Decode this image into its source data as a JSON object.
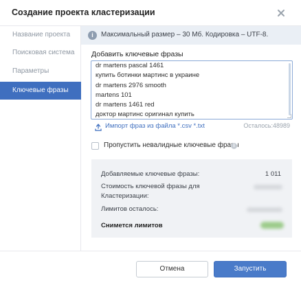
{
  "dialog": {
    "title": "Создание проекта кластеризации",
    "close_icon": "close-icon"
  },
  "sidebar": {
    "items": [
      {
        "label": "Название проекта",
        "active": false
      },
      {
        "label": "Поисковая система",
        "active": false
      },
      {
        "label": "Параметры",
        "active": false
      },
      {
        "label": "Ключевые фразы",
        "active": true
      }
    ]
  },
  "info": {
    "icon": "info-icon",
    "text": "Максимальный размер – 30 Мб. Кодировка – UTF-8."
  },
  "keywords": {
    "label": "Добавить ключевые фразы",
    "phrases": [
      "dr martens pascal 1461",
      "купить ботинки мартинс в украине",
      "dr martens 2976 smooth",
      "martens 101",
      "dr martens 1461 red",
      "доктор мартинс оригинал купить"
    ],
    "import_icon": "upload-icon",
    "import_label": "Импорт фраз из файла *.csv *.txt",
    "remaining": "Осталось:48989"
  },
  "skip_invalid": {
    "label": "Пропустить невалидные ключевые фразы",
    "checked": false,
    "help_icon": "help-icon"
  },
  "summary": {
    "added_label": "Добавляемые ключевые фразы:",
    "added_value": "1 011",
    "cost_label_line1": "Стоимость ключевой фразы для",
    "cost_label_line2": "Кластеризации:",
    "limits_left_label": "Лимитов осталось:",
    "will_charge_label": "Снимется лимитов"
  },
  "footer": {
    "cancel_label": "Отмена",
    "start_label": "Запустить"
  },
  "colors": {
    "accent": "#3f6fbf",
    "button_primary": "#4a7bc9",
    "info_bg": "#eaeff5",
    "summary_bg": "#f0f2f5"
  }
}
